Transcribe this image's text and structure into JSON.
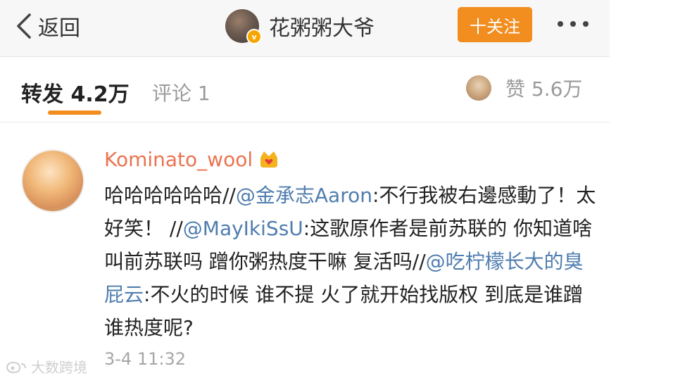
{
  "header": {
    "back_label": "返回",
    "title": "花粥粥大爷",
    "follow_label": "十关注"
  },
  "tabs": {
    "repost_label": "转发 4.2万",
    "comment_label": "评论 1",
    "like_label": "赞 5.6万"
  },
  "post": {
    "author": "Kominato_wool",
    "segments": [
      {
        "text": "哈哈哈哈哈哈//",
        "type": "text"
      },
      {
        "text": "@金承志Aaron",
        "type": "mention"
      },
      {
        "text": ":不行我被右邊感動了！太好笑！ //",
        "type": "text"
      },
      {
        "text": "@MayIkiSsU",
        "type": "mention"
      },
      {
        "text": ":这歌原作者是前苏联的 你知道啥叫前苏联吗 蹭你粥热度干嘛 复活吗//",
        "type": "text"
      },
      {
        "text": "@吃柠檬长大的臭屁云",
        "type": "mention"
      },
      {
        "text": ":不火的时候 谁不提 火了就开始找版权 到底是谁蹭谁热度呢?",
        "type": "text"
      }
    ],
    "time": "3-4 11:32"
  },
  "watermark": "大数跨境",
  "colors": {
    "accent": "#f28d1f",
    "author": "#eb7350",
    "mention": "#507daf"
  }
}
